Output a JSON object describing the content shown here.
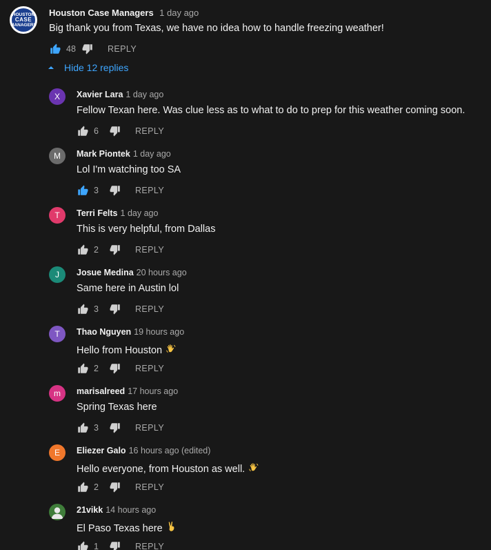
{
  "top_comment": {
    "avatar_lines": [
      "HOUSTON",
      "CASE",
      "MANAGERS"
    ],
    "author": "Houston Case Managers",
    "time": "1 day ago",
    "text": "Big thank you from Texas, we have no idea how to handle freezing weather!",
    "likes": "48",
    "liked": true,
    "reply_label": "REPLY"
  },
  "replies_toggle": {
    "label": "Hide 12 replies"
  },
  "replies": [
    {
      "initial": "X",
      "avatar_color": "#6a34b0",
      "author": "Xavier Lara",
      "time": "1 day ago",
      "text": "Fellow Texan here. Was clue less as to what to do to prep for this weather coming soon.",
      "emoji": "",
      "likes": "6",
      "liked": false,
      "reply_label": "REPLY"
    },
    {
      "initial": "M",
      "avatar_color": "#6b6b6b",
      "author": "Mark Piontek",
      "time": "1 day ago",
      "text": "Lol I'm watching too SA",
      "emoji": "",
      "likes": "3",
      "liked": true,
      "reply_label": "REPLY"
    },
    {
      "initial": "T",
      "avatar_color": "#e03a6b",
      "author": "Terri Felts",
      "time": "1 day ago",
      "text": "This is very helpful, from Dallas",
      "emoji": "",
      "likes": "2",
      "liked": false,
      "reply_label": "REPLY"
    },
    {
      "initial": "J",
      "avatar_color": "#1b8a78",
      "author": "Josue Medina",
      "time": "20 hours ago",
      "text": "Same here in Austin lol",
      "emoji": "",
      "likes": "3",
      "liked": false,
      "reply_label": "REPLY"
    },
    {
      "initial": "T",
      "avatar_color": "#7e57c2",
      "author": "Thao Nguyen",
      "time": "19 hours ago",
      "text": "Hello from Houston",
      "emoji": "wave",
      "likes": "2",
      "liked": false,
      "reply_label": "REPLY"
    },
    {
      "initial": "m",
      "avatar_color": "#d63384",
      "author": "marisalreed",
      "time": "17 hours ago",
      "text": "Spring Texas here",
      "emoji": "",
      "likes": "3",
      "liked": false,
      "reply_label": "REPLY"
    },
    {
      "initial": "E",
      "avatar_color": "#f0772b",
      "author": "Eliezer Galo",
      "time": "16 hours ago (edited)",
      "text": "Hello everyone, from Houston as well.",
      "emoji": "wave",
      "likes": "2",
      "liked": false,
      "reply_label": "REPLY"
    },
    {
      "initial": "",
      "avatar_color": "#3f7d3a",
      "author": "21vikk",
      "time": "14 hours ago",
      "text": "El Paso Texas here",
      "emoji": "victory",
      "likes": "1",
      "liked": false,
      "reply_label": "REPLY"
    }
  ],
  "colors": {
    "background": "#181818",
    "link": "#3ea6ff",
    "liked_icon": "#3ea6ff",
    "icon": "#d0d0d0",
    "secondary_text": "#aaaaaa"
  },
  "icons": {
    "like": "thumbs-up-icon",
    "dislike": "thumbs-down-icon",
    "toggle": "caret-up-icon",
    "emoji_wave": "waving-hand-emoji",
    "emoji_victory": "victory-hand-emoji",
    "default_avatar": "person-icon"
  }
}
